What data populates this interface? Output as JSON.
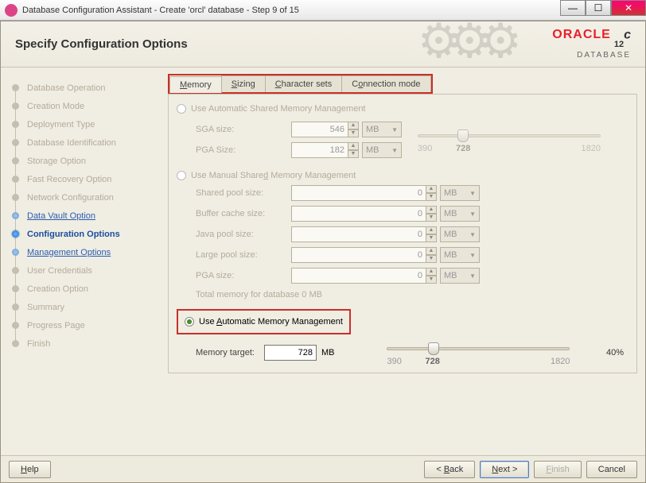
{
  "window": {
    "title": "Database Configuration Assistant - Create 'orcl' database - Step 9 of 15"
  },
  "header": {
    "title": "Specify Configuration Options",
    "brand": "ORACLE",
    "brand_sub": "DATABASE",
    "version": "12",
    "version_suffix": "c"
  },
  "steps": {
    "items": [
      {
        "label": "Database Operation",
        "state": "disabled"
      },
      {
        "label": "Creation Mode",
        "state": "disabled"
      },
      {
        "label": "Deployment Type",
        "state": "disabled"
      },
      {
        "label": "Database Identification",
        "state": "disabled"
      },
      {
        "label": "Storage Option",
        "state": "disabled"
      },
      {
        "label": "Fast Recovery Option",
        "state": "disabled"
      },
      {
        "label": "Network Configuration",
        "state": "disabled"
      },
      {
        "label": "Data Vault Option",
        "state": "link"
      },
      {
        "label": "Configuration Options",
        "state": "current"
      },
      {
        "label": "Management Options",
        "state": "link"
      },
      {
        "label": "User Credentials",
        "state": "disabled"
      },
      {
        "label": "Creation Option",
        "state": "disabled"
      },
      {
        "label": "Summary",
        "state": "disabled"
      },
      {
        "label": "Progress Page",
        "state": "disabled"
      },
      {
        "label": "Finish",
        "state": "disabled"
      }
    ]
  },
  "tabs": {
    "memory": "Memory",
    "sizing": "Sizing",
    "charsets": "Character sets",
    "connmode": "Connection mode"
  },
  "memory": {
    "opt_auto_shared": "Use Automatic Shared Memory Management",
    "sga_label": "SGA size:",
    "sga_value": "546",
    "pga_label": "PGA Size:",
    "pga_value": "182",
    "unit_mb": "MB",
    "slider1": {
      "min": "390",
      "val": "728",
      "max": "1820"
    },
    "opt_manual": "Use Manual Shared Memory Management",
    "shared_pool": "Shared pool size:",
    "buffer_cache": "Buffer cache size:",
    "java_pool": "Java pool size:",
    "large_pool": "Large pool size:",
    "pga_size2": "PGA size:",
    "zero": "0",
    "total": "Total memory for database 0 MB",
    "opt_auto": "Use Automatic Memory Management",
    "target_label": "Memory target:",
    "target_value": "728",
    "target_unit": "MB",
    "slider2": {
      "min": "390",
      "val": "728",
      "max": "1820"
    },
    "pct": "40%"
  },
  "footer": {
    "help": "Help",
    "back": "< Back",
    "next": "Next >",
    "finish": "Finish",
    "cancel": "Cancel"
  }
}
